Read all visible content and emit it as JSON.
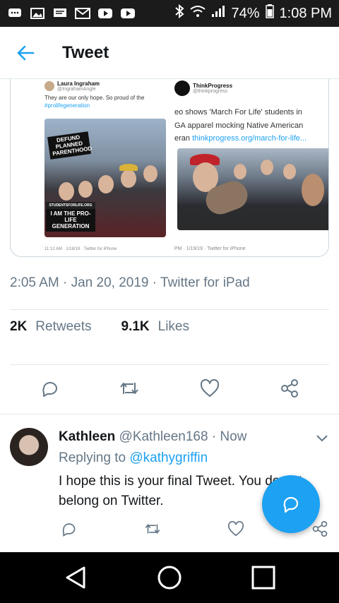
{
  "status_bar": {
    "battery": "74%",
    "time": "1:08 PM",
    "icons": [
      "chat-icon",
      "image-icon",
      "message-icon",
      "gmail-icon",
      "youtube-icon",
      "youtube-icon",
      "bluetooth-icon",
      "wifi-icon",
      "signal-icon",
      "battery-icon"
    ]
  },
  "header": {
    "title": "Tweet",
    "back_icon": "back-arrow-icon"
  },
  "media": {
    "left": {
      "name": "Laura Ingraham",
      "handle": "@IngrahamAngle",
      "text": "They are our only hope.  So proud of the",
      "hashtag": "#prolifegeneration",
      "sign1": "DEFUND PLANNED PARENTHOOD",
      "sign2": "I AM THE PRO-LIFE GENERATION",
      "sign_top": "STUDENTSFORLIFE.ORG",
      "footer": "11:12 AM · 1/18/19 · Twitter for iPhone"
    },
    "right": {
      "name": "ThinkProgress",
      "handle": "@thinkprogress",
      "line1": "eo shows 'March For Life' students in",
      "line2": "GA apparel mocking Native American",
      "line3_prefix": "eran",
      "line3_link": "thinkprogress.org/march-for-life...",
      "footer": "PM · 1/19/19 · Twitter for iPhone"
    }
  },
  "meta": {
    "time": "2:05 AM",
    "date": "Jan 20, 2019",
    "source": "Twitter for iPad",
    "line": "2:05 AM · Jan 20, 2019 · Twitter for iPad"
  },
  "stats": {
    "retweets_count": "2K",
    "retweets_label": "Retweets",
    "likes_count": "9.1K",
    "likes_label": "Likes"
  },
  "actions": [
    "reply-icon",
    "retweet-icon",
    "like-icon",
    "share-icon"
  ],
  "reply": {
    "name": "Kathleen",
    "handle": "@Kathleen168",
    "time": "· Now",
    "replying_prefix": "Replying to",
    "replying_to": "@kathygriffin",
    "text_line1": "I hope this is your final Tweet. You do not",
    "text_line2": "belong on Twitter."
  },
  "colors": {
    "accent": "#1da1f2",
    "muted": "#657786",
    "text": "#14171a",
    "border": "#e1e8ed"
  }
}
